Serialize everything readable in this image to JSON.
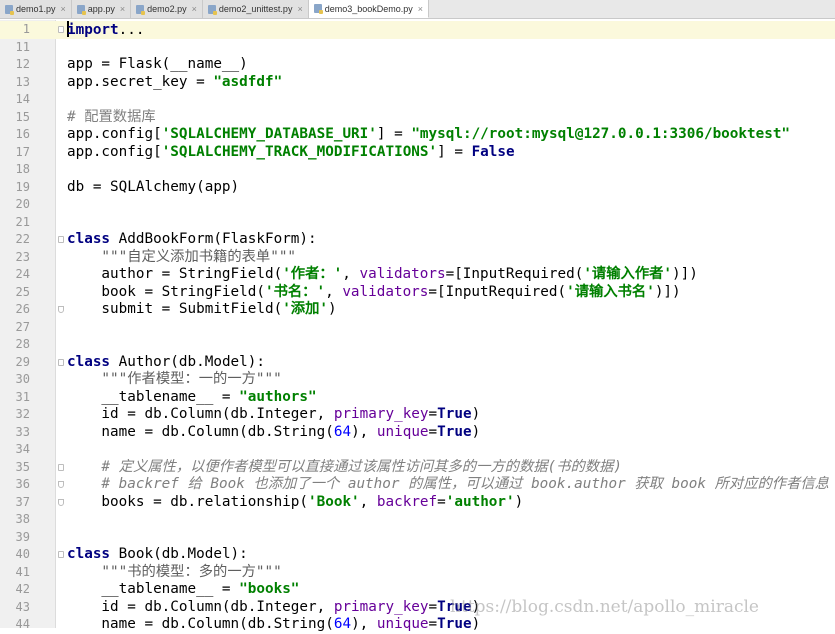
{
  "tabs": [
    {
      "label": "demo1.py",
      "active": false
    },
    {
      "label": "app.py",
      "active": false
    },
    {
      "label": "demo2.py",
      "active": false
    },
    {
      "label": "demo2_unittest.py",
      "active": false
    },
    {
      "label": "demo3_bookDemo.py",
      "active": true
    }
  ],
  "watermark": "https://blog.csdn.net/apollo_miracle",
  "lines": [
    {
      "n": "1",
      "fold": "start",
      "current": true,
      "caret": true,
      "segs": [
        [
          "kw",
          "import"
        ],
        [
          "",
          "..."
        ]
      ]
    },
    {
      "n": "11",
      "segs": []
    },
    {
      "n": "12",
      "segs": [
        [
          "",
          "app = Flask(__name__)"
        ]
      ]
    },
    {
      "n": "13",
      "segs": [
        [
          "",
          "app.secret_key = "
        ],
        [
          "str",
          "\"asdfdf\""
        ]
      ]
    },
    {
      "n": "14",
      "segs": []
    },
    {
      "n": "15",
      "segs": [
        [
          "cmt",
          "# 配置数据库"
        ]
      ]
    },
    {
      "n": "16",
      "segs": [
        [
          "",
          "app.config["
        ],
        [
          "str",
          "'SQLALCHEMY_DATABASE_URI'"
        ],
        [
          "",
          "] = "
        ],
        [
          "str",
          "\"mysql://root:mysql@127.0.0.1:3306/booktest\""
        ]
      ]
    },
    {
      "n": "17",
      "segs": [
        [
          "",
          "app.config["
        ],
        [
          "str",
          "'SQLALCHEMY_TRACK_MODIFICATIONS'"
        ],
        [
          "",
          "] = "
        ],
        [
          "kw",
          "False"
        ]
      ]
    },
    {
      "n": "18",
      "segs": []
    },
    {
      "n": "19",
      "segs": [
        [
          "",
          "db = SQLAlchemy(app)"
        ]
      ]
    },
    {
      "n": "20",
      "segs": []
    },
    {
      "n": "21",
      "segs": []
    },
    {
      "n": "22",
      "fold": "start",
      "segs": [
        [
          "kw",
          "class"
        ],
        [
          "",
          " AddBookForm(FlaskForm):"
        ]
      ]
    },
    {
      "n": "23",
      "segs": [
        [
          "doc",
          "    \"\"\"自定义添加书籍的表单\"\"\""
        ]
      ]
    },
    {
      "n": "24",
      "segs": [
        [
          "",
          "    author = StringField("
        ],
        [
          "str",
          "'作者：'"
        ],
        [
          "",
          ", "
        ],
        [
          "named",
          "validators"
        ],
        [
          "",
          "=[InputRequired("
        ],
        [
          "str",
          "'请输入作者'"
        ],
        [
          "",
          ")])"
        ]
      ]
    },
    {
      "n": "25",
      "segs": [
        [
          "",
          "    book = StringField("
        ],
        [
          "str",
          "'书名：'"
        ],
        [
          "",
          ", "
        ],
        [
          "named",
          "validators"
        ],
        [
          "",
          "=[InputRequired("
        ],
        [
          "str",
          "'请输入书名'"
        ],
        [
          "",
          ")])"
        ]
      ]
    },
    {
      "n": "26",
      "fold": "end",
      "segs": [
        [
          "",
          "    submit = SubmitField("
        ],
        [
          "str",
          "'添加'"
        ],
        [
          "",
          ")"
        ]
      ]
    },
    {
      "n": "27",
      "segs": []
    },
    {
      "n": "28",
      "segs": []
    },
    {
      "n": "29",
      "fold": "start",
      "segs": [
        [
          "kw",
          "class"
        ],
        [
          "",
          " Author(db.Model):"
        ]
      ]
    },
    {
      "n": "30",
      "segs": [
        [
          "doc",
          "    \"\"\"作者模型：一的一方\"\"\""
        ]
      ]
    },
    {
      "n": "31",
      "segs": [
        [
          "",
          "    __tablename__ = "
        ],
        [
          "str",
          "\"authors\""
        ]
      ]
    },
    {
      "n": "32",
      "segs": [
        [
          "",
          "    id = db.Column(db.Integer, "
        ],
        [
          "named",
          "primary_key"
        ],
        [
          "",
          "="
        ],
        [
          "kw",
          "True"
        ],
        [
          "",
          ")"
        ]
      ]
    },
    {
      "n": "33",
      "segs": [
        [
          "",
          "    name = db.Column(db.String("
        ],
        [
          "num",
          "64"
        ],
        [
          "",
          "), "
        ],
        [
          "named",
          "unique"
        ],
        [
          "",
          "="
        ],
        [
          "kw",
          "True"
        ],
        [
          "",
          ")"
        ]
      ]
    },
    {
      "n": "34",
      "segs": []
    },
    {
      "n": "35",
      "fold": "start",
      "segs": [
        [
          "cmti",
          "    # 定义属性，以便作者模型可以直接通过该属性访问其多的一方的数据(书的数据)"
        ]
      ]
    },
    {
      "n": "36",
      "fold": "end",
      "segs": [
        [
          "cmti",
          "    # backref 给 Book 也添加了一个 author 的属性，可以通过 book.author 获取 book 所对应的作者信息"
        ]
      ]
    },
    {
      "n": "37",
      "fold": "end",
      "segs": [
        [
          "",
          "    books = db.relationship("
        ],
        [
          "str",
          "'Book'"
        ],
        [
          "",
          ", "
        ],
        [
          "named",
          "backref"
        ],
        [
          "",
          "="
        ],
        [
          "str",
          "'author'"
        ],
        [
          "",
          ")"
        ]
      ]
    },
    {
      "n": "38",
      "segs": []
    },
    {
      "n": "39",
      "segs": []
    },
    {
      "n": "40",
      "fold": "start",
      "segs": [
        [
          "kw",
          "class"
        ],
        [
          "",
          " Book(db.Model):"
        ]
      ]
    },
    {
      "n": "41",
      "segs": [
        [
          "doc",
          "    \"\"\"书的模型：多的一方\"\"\""
        ]
      ]
    },
    {
      "n": "42",
      "segs": [
        [
          "",
          "    __tablename__ = "
        ],
        [
          "str",
          "\"books\""
        ]
      ]
    },
    {
      "n": "43",
      "segs": [
        [
          "",
          "    id = db.Column(db.Integer, "
        ],
        [
          "named",
          "primary_key"
        ],
        [
          "",
          "="
        ],
        [
          "kw",
          "True"
        ],
        [
          "",
          ")"
        ]
      ]
    },
    {
      "n": "44",
      "segs": [
        [
          "",
          "    name = db.Column(db.String("
        ],
        [
          "num",
          "64"
        ],
        [
          "",
          "), "
        ],
        [
          "named",
          "unique"
        ],
        [
          "",
          "="
        ],
        [
          "kw",
          "True"
        ],
        [
          "",
          ")"
        ]
      ]
    }
  ]
}
